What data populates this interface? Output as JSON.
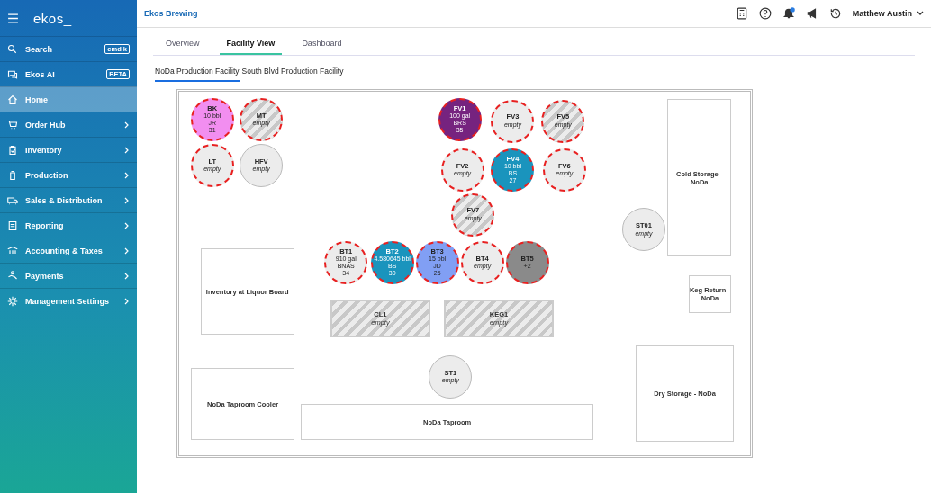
{
  "sidebar": {
    "logo": "ekos_",
    "items": [
      {
        "label": "Search",
        "badge": "cmd k",
        "has_submenu": false,
        "selected": false
      },
      {
        "label": "Ekos AI",
        "badge": "BETA",
        "has_submenu": false,
        "selected": false
      },
      {
        "label": "Home",
        "has_submenu": false,
        "selected": true
      },
      {
        "label": "Order Hub",
        "has_submenu": true,
        "selected": false
      },
      {
        "label": "Inventory",
        "has_submenu": true,
        "selected": false
      },
      {
        "label": "Production",
        "has_submenu": true,
        "selected": false
      },
      {
        "label": "Sales & Distribution",
        "has_submenu": true,
        "selected": false
      },
      {
        "label": "Reporting",
        "has_submenu": true,
        "selected": false
      },
      {
        "label": "Accounting & Taxes",
        "has_submenu": true,
        "selected": false
      },
      {
        "label": "Payments",
        "has_submenu": true,
        "selected": false
      },
      {
        "label": "Management Settings",
        "has_submenu": true,
        "selected": false
      }
    ]
  },
  "header": {
    "company": "Ekos Brewing",
    "user": "Matthew Austin"
  },
  "tabs": [
    {
      "label": "Overview",
      "selected": false
    },
    {
      "label": "Facility View",
      "selected": true
    },
    {
      "label": "Dashboard",
      "selected": false
    }
  ],
  "facility_tabs": [
    {
      "label": "NoDa Production Facility",
      "selected": true
    },
    {
      "label": "South Blvd Production Facility",
      "selected": false
    }
  ],
  "vessels": [
    {
      "name": "BK",
      "contents": [
        "10 bbl",
        "JR",
        "31"
      ],
      "filled": true,
      "alert": true,
      "hatched": false,
      "color": "#f28ef0"
    },
    {
      "name": "MT",
      "contents": [
        "empty"
      ],
      "filled": false,
      "alert": true,
      "hatched": true
    },
    {
      "name": "LT",
      "contents": [
        "empty"
      ],
      "filled": false,
      "alert": true,
      "hatched": false
    },
    {
      "name": "HFV",
      "contents": [
        "empty"
      ],
      "filled": false,
      "alert": false,
      "hatched": false
    },
    {
      "name": "FV1",
      "contents": [
        "100 gal",
        "BRS",
        "35"
      ],
      "filled": true,
      "alert": true,
      "hatched": false,
      "color": "#76237f"
    },
    {
      "name": "FV3",
      "contents": [
        "empty"
      ],
      "filled": false,
      "alert": true,
      "hatched": false
    },
    {
      "name": "FV5",
      "contents": [
        "empty"
      ],
      "filled": false,
      "alert": true,
      "hatched": true
    },
    {
      "name": "FV2",
      "contents": [
        "empty"
      ],
      "filled": false,
      "alert": true,
      "hatched": false
    },
    {
      "name": "FV4",
      "contents": [
        "10 bbl",
        "BS",
        "27"
      ],
      "filled": true,
      "alert": true,
      "hatched": false,
      "color": "#1a94bd"
    },
    {
      "name": "FV6",
      "contents": [
        "empty"
      ],
      "filled": false,
      "alert": true,
      "hatched": false
    },
    {
      "name": "FV7",
      "contents": [
        "empty"
      ],
      "filled": false,
      "alert": true,
      "hatched": true
    },
    {
      "name": "BT1",
      "contents": [
        "910 gal",
        "BNAS",
        "34"
      ],
      "filled": true,
      "alert": true,
      "hatched": false
    },
    {
      "name": "BT2",
      "contents": [
        "4.580645 bbl",
        "BS",
        "30"
      ],
      "filled": true,
      "alert": true,
      "hatched": false,
      "color": "#1a94bd"
    },
    {
      "name": "BT3",
      "contents": [
        "15 bbl",
        "JD",
        "25"
      ],
      "filled": true,
      "alert": true,
      "hatched": false,
      "color": "#819ff4"
    },
    {
      "name": "BT4",
      "contents": [
        "empty"
      ],
      "filled": false,
      "alert": true,
      "hatched": false
    },
    {
      "name": "BT5",
      "contents": [
        "+2"
      ],
      "filled": true,
      "alert": true,
      "hatched": false,
      "color": "#8a8a8a"
    },
    {
      "name": "ST01",
      "contents": [
        "empty"
      ],
      "filled": false,
      "alert": false,
      "hatched": false
    },
    {
      "name": "ST1",
      "contents": [
        "empty"
      ],
      "filled": false,
      "alert": false,
      "hatched": false
    }
  ],
  "areas": [
    {
      "name": "Cold Storage - NoDa",
      "hatched": false
    },
    {
      "name": "Keg Return - NoDa",
      "hatched": false
    },
    {
      "name": "Dry Storage - NoDa",
      "hatched": false
    },
    {
      "name": "Inventory at Liquor Board",
      "hatched": false
    },
    {
      "name": "NoDa Taproom Cooler",
      "hatched": false
    },
    {
      "name": "NoDa Taproom",
      "hatched": false
    },
    {
      "name": "CL1",
      "contents": "empty",
      "hatched": true
    },
    {
      "name": "KEG1",
      "contents": "empty",
      "hatched": true
    }
  ]
}
